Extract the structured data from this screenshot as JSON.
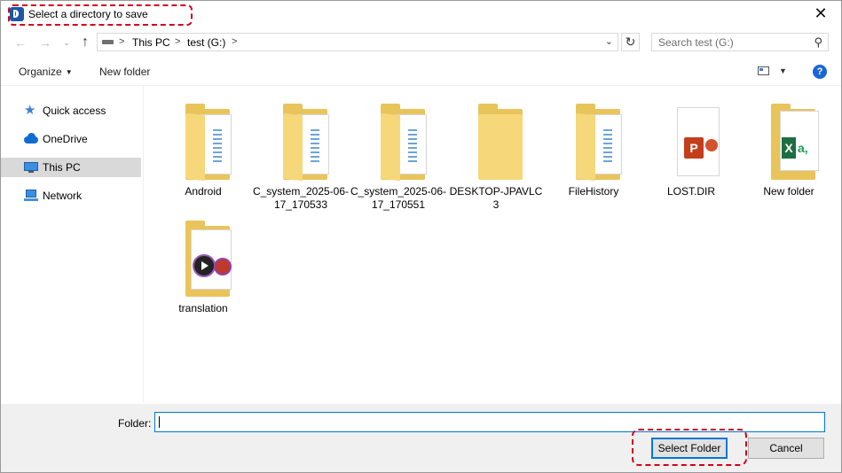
{
  "window": {
    "title": "Select a directory to save",
    "close_glyph": "✕"
  },
  "nav": {
    "back_glyph": "←",
    "forward_glyph": "→",
    "recent_glyph": "⌄",
    "up_glyph": "↑",
    "breadcrumbs": [
      "This PC",
      "test (G:)"
    ],
    "separator": ">",
    "refresh_glyph": "↻",
    "dropdown_glyph": "⌄"
  },
  "search": {
    "placeholder": "Search test (G:)",
    "icon_glyph": "⚲"
  },
  "toolbar": {
    "organize_label": "Organize",
    "organize_caret": "▼",
    "new_folder_label": "New folder",
    "view_caret": "▼",
    "help_glyph": "?"
  },
  "sidebar": {
    "items": [
      {
        "label": "Quick access",
        "icon": "star-icon"
      },
      {
        "label": "OneDrive",
        "icon": "cloud-icon"
      },
      {
        "label": "This PC",
        "icon": "computer-icon",
        "selected": true
      },
      {
        "label": "Network",
        "icon": "network-icon"
      }
    ]
  },
  "content": {
    "items": [
      {
        "label": "Android",
        "type": "folder-docs"
      },
      {
        "label": "C_system_2025-06-17_170533",
        "type": "folder-docs"
      },
      {
        "label": "C_system_2025-06-17_170551",
        "type": "folder-docs"
      },
      {
        "label": "DESKTOP-JPAVLC3",
        "type": "folder-empty"
      },
      {
        "label": "FileHistory",
        "type": "folder-docs"
      },
      {
        "label": "LOST.DIR",
        "type": "folder-ppt"
      },
      {
        "label": "New folder",
        "type": "folder-excel"
      },
      {
        "label": "translation",
        "type": "folder-media"
      }
    ],
    "badge_ppt": "P",
    "badge_xl": "X",
    "badge_xl_cell": "a,"
  },
  "bottom": {
    "folder_label": "Folder:",
    "folder_value": "",
    "select_button": "Select Folder",
    "cancel_button": "Cancel"
  },
  "colors": {
    "accent": "#0078d7",
    "highlight": "#d0021b",
    "folder": "#f6d77a"
  }
}
